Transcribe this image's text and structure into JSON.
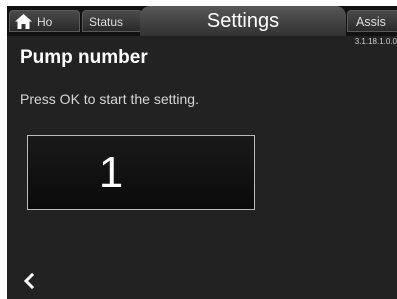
{
  "tabs": {
    "home_label": "Ho",
    "status_label": "Status",
    "settings_label": "Settings",
    "assist_label": "Assis"
  },
  "version": "3.1.18.1.0.0",
  "page": {
    "title": "Pump number",
    "instruction": "Press OK to start the setting.",
    "value": "1"
  },
  "icons": {
    "home": "home-icon",
    "back": "chevron-left-icon"
  },
  "colors": {
    "background": "#222222",
    "text": "#ffffff"
  }
}
